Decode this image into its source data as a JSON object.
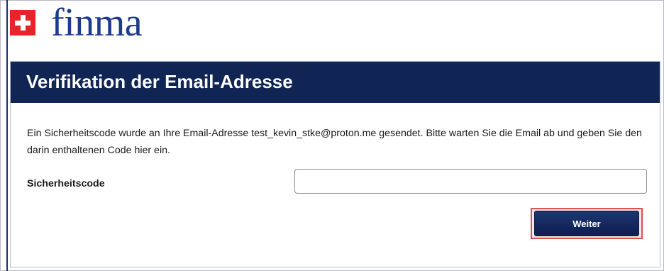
{
  "brand": {
    "logo_text": "finma",
    "flag_icon": "swiss-flag-icon",
    "logo_color": "#1e3a8c",
    "flag_color": "#e8232a"
  },
  "panel": {
    "title": "Verifikation der Email-Adresse",
    "header_color": "#112555",
    "message": "Ein Sicherheitscode wurde an Ihre Email-Adresse test_kevin_stke@proton.me gesendet. Bitte warten Sie die Email ab und geben Sie den darin enthaltenen Code hier ein.",
    "field_label": "Sicherheitscode",
    "code_value": "",
    "submit_label": "Weiter",
    "highlight_color": "#d9534f"
  }
}
